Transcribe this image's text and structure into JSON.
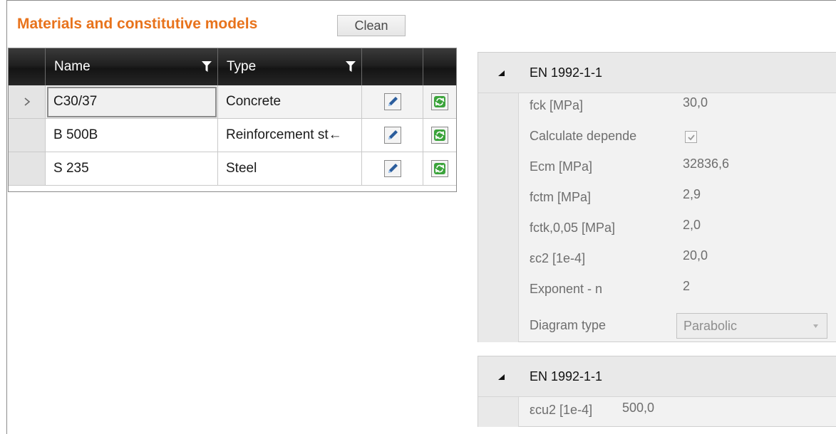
{
  "header": {
    "title": "Materials and constitutive models",
    "clean_label": "Clean"
  },
  "materials_grid": {
    "columns": [
      "Name",
      "Type"
    ],
    "rows": [
      {
        "name": "C30/37",
        "type": "Concrete",
        "selected": true
      },
      {
        "name": "B 500B",
        "type": "Reinforcement st←",
        "selected": false
      },
      {
        "name": "S 235",
        "type": "Steel",
        "selected": false
      }
    ],
    "icons": {
      "edit": "edit-pencil-icon",
      "refresh": "refresh-icon",
      "filter": "filter-icon",
      "row_indicator": "chevron-right-icon"
    }
  },
  "panel_concrete": {
    "title": "EN 1992-1-1",
    "props": [
      {
        "label": "fck [MPa]",
        "value": "30,0"
      },
      {
        "label": "Calculate depende",
        "value": "",
        "checked": true
      },
      {
        "label": "Ecm [MPa]",
        "value": "32836,6"
      },
      {
        "label": "fctm [MPa]",
        "value": "2,9"
      },
      {
        "label": "fctk,0,05 [MPa]",
        "value": "2,0"
      },
      {
        "label": "εc2 [1e-4]",
        "value": "20,0"
      },
      {
        "label": "Exponent - n",
        "value": "2"
      },
      {
        "label": "Diagram type",
        "value": "Parabolic"
      }
    ]
  },
  "panel_reinforcement": {
    "title": "EN 1992-1-1",
    "props": [
      {
        "label": "εcu2 [1e-4]",
        "value": "500,0"
      }
    ]
  },
  "colors": {
    "title_accent": "#e8731c",
    "grid_header": "#1c1c1c",
    "edit_icon_blue": "#2b5d9c",
    "refresh_icon_green": "#3aa33a"
  }
}
